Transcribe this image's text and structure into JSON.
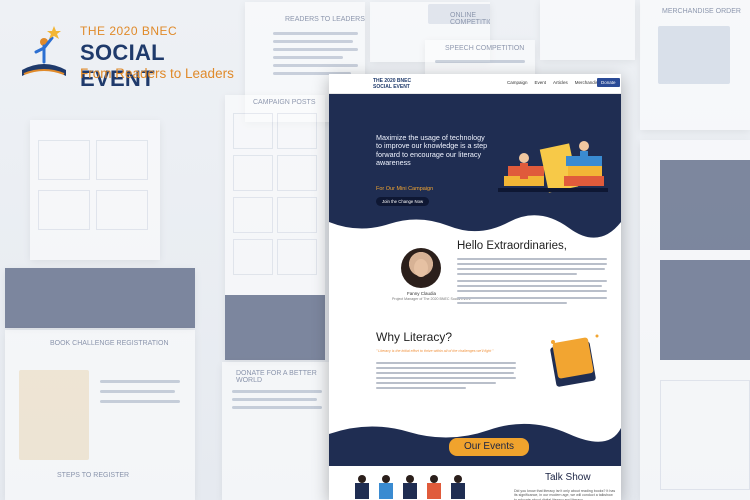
{
  "logo": {
    "line1": "THE 2020 BNEC",
    "line2": "SOCIAL EVENT",
    "line3": "From Readers to Leaders"
  },
  "nav": {
    "brand_line1": "THE 2020 BNEC",
    "brand_line2": "SOCIAL EVENT",
    "items": [
      "Campaign",
      "Event",
      "Articles",
      "Merchandise"
    ],
    "donate_label": "Donate"
  },
  "hero": {
    "headline": "Maximize the usage of technology to improve our knowledge is a step forward to encourage our literacy awareness",
    "subheadline": "For Our Mini Campaign",
    "cta_label": "Join the Change Now"
  },
  "intro": {
    "greeting": "Hello Extraordinaries,",
    "person_name": "Fanny Claudia",
    "person_role": "Project Manager of The 2020 BNEC Social Event"
  },
  "why": {
    "title": "Why Literacy?",
    "quote": "\" Literacy is the initial effort to thrive within all of the challenges we'll fight \""
  },
  "events": {
    "button_label": "Our Events",
    "talk_title": "Talk Show",
    "talk_desc": "Did you know that literacy isn't only about reading books? It has its significance, in our modern age, we will conduct a talkshow to educate about digital literacy and literacy"
  },
  "ghost_labels": {
    "readers": "READERS TO LEADERS",
    "online": "ONLINE COMPETITION",
    "speech": "SPEECH COMPETITION",
    "merch": "MERCHANDISE ORDER",
    "campaign": "CAMPAIGN POSTS",
    "challenge": "BOOK CHALLENGE REGISTRATION",
    "donate": "DONATE FOR A BETTER WORLD",
    "steps": "STEPS TO REGISTER"
  }
}
